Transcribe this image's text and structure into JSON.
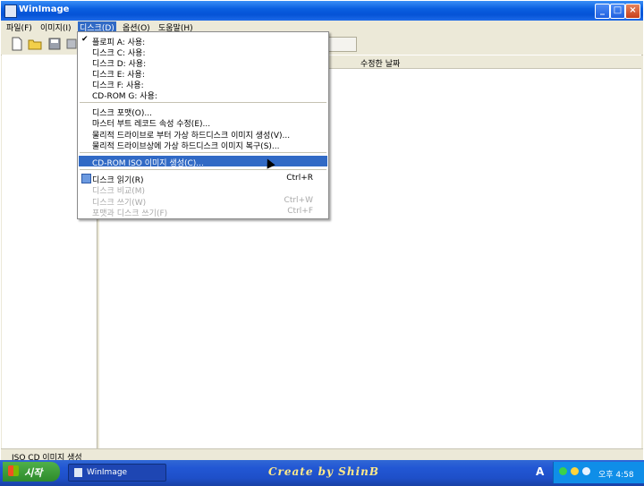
{
  "window": {
    "title": "WinImage"
  },
  "menubar": [
    {
      "label": "파일(F)"
    },
    {
      "label": "이미지(I)"
    },
    {
      "label": "디스크(D)"
    },
    {
      "label": "옵션(O)"
    },
    {
      "label": "도움말(H)"
    }
  ],
  "columns": {
    "modified": "수정한 날짜"
  },
  "disk_menu": {
    "drives": [
      {
        "label": "플로피 A: 사용:",
        "checked": true
      },
      {
        "label": "디스크 C: 사용:"
      },
      {
        "label": "디스크 D: 사용:"
      },
      {
        "label": "디스크 E: 사용:"
      },
      {
        "label": "디스크 F: 사용:"
      },
      {
        "label": "CD-ROM G: 사용:"
      }
    ],
    "tools": [
      {
        "label": "디스크 포맷(O)..."
      },
      {
        "label": "마스터 부트 레코드 속성 수정(E)..."
      },
      {
        "label": "물리적 드라이브로 부터 가상 하드디스크 이미지 생성(V)..."
      },
      {
        "label": "물리적 드라이브상에 가상 하드디스크 이미지 복구(S)..."
      }
    ],
    "highlighted": {
      "label": "CD-ROM ISO 이미지 생성(C)..."
    },
    "actions": [
      {
        "label": "디스크 읽기(R)",
        "shortcut": "Ctrl+R",
        "enabled": true
      },
      {
        "label": "디스크 비교(M)",
        "shortcut": "",
        "enabled": false
      },
      {
        "label": "디스크 쓰기(W)",
        "shortcut": "Ctrl+W",
        "enabled": false
      },
      {
        "label": "포맷과 디스크 쓰기(F)",
        "shortcut": "Ctrl+F",
        "enabled": false
      }
    ]
  },
  "status": {
    "text": "ISO CD 이미지 생성"
  },
  "taskbar": {
    "start_label": "시작",
    "task_label": "WinImage",
    "banner": "Create by ShinB",
    "ime": "A",
    "clock": "오후 4:58"
  },
  "colors": {
    "accent": "#316ac5",
    "titlebar": "#0a5fe0",
    "taskbar": "#2257d4"
  }
}
